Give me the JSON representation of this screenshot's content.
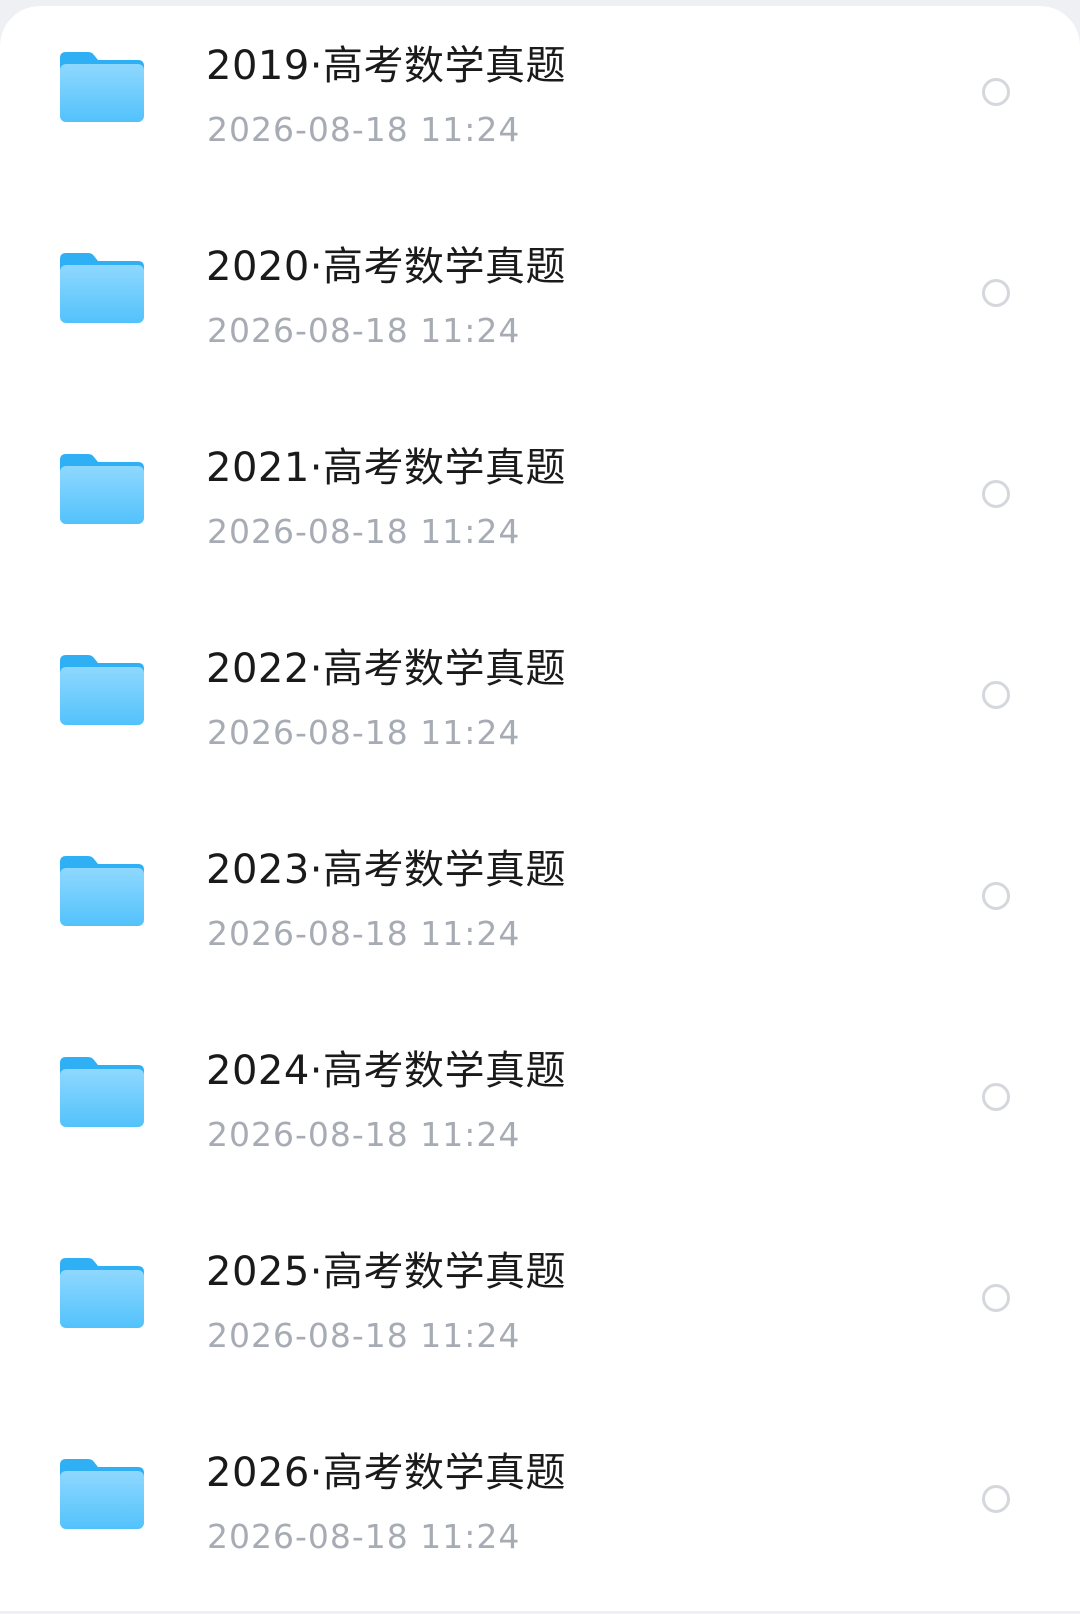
{
  "files": [
    {
      "name": "2019·高考数学真题",
      "date": "2026-08-18  11:24",
      "icon": "folder-icon"
    },
    {
      "name": "2020·高考数学真题",
      "date": "2026-08-18  11:24",
      "icon": "folder-icon"
    },
    {
      "name": "2021·高考数学真题",
      "date": "2026-08-18  11:24",
      "icon": "folder-icon"
    },
    {
      "name": "2022·高考数学真题",
      "date": "2026-08-18  11:24",
      "icon": "folder-icon"
    },
    {
      "name": "2023·高考数学真题",
      "date": "2026-08-18  11:24",
      "icon": "folder-icon"
    },
    {
      "name": "2024·高考数学真题",
      "date": "2026-08-18  11:24",
      "icon": "folder-icon"
    },
    {
      "name": "2025·高考数学真题",
      "date": "2026-08-18  11:24",
      "icon": "folder-icon"
    },
    {
      "name": "2026·高考数学真题",
      "date": "2026-08-18  11:24",
      "icon": "folder-icon"
    }
  ],
  "colors": {
    "folder_top": "#8fd8ff",
    "folder_bottom": "#52c2fb",
    "folder_tab": "#2fb0f5",
    "title": "#1a1a1a",
    "meta": "#a7acb4",
    "radio_border": "#d4d7dc"
  }
}
